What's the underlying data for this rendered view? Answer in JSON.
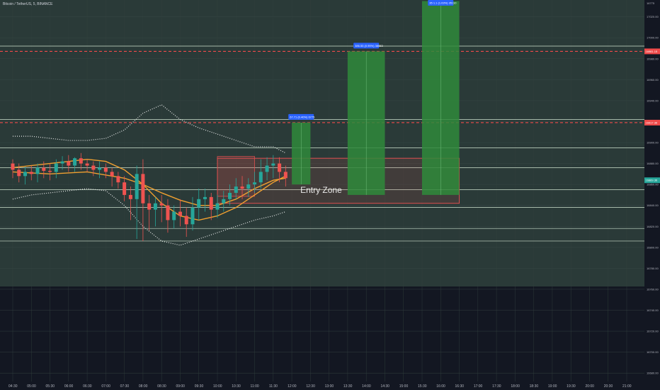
{
  "header": {
    "symbol_line": "Bitcoin / TetherUS, 5, BINANCE"
  },
  "colors": {
    "bg_chart": "#2a3a38",
    "bg_lower": "#131722",
    "hline": "#cfe3cf",
    "red_dash": "#ef4a4a",
    "target_green": "#2f8a3b",
    "zone_border": "#e05050",
    "ma_orange": "#f0a030",
    "bull": "#26a69a",
    "bear": "#ef5350",
    "label_blue": "#2962ff"
  },
  "labels": {
    "entry_zone": "Entry Zone",
    "target_1": "67.71 (0.40%) 6775",
    "target_2": "386.53 (0.95%) 38653",
    "target_3": "35 1.1 (1.03%) 35110",
    "current_price": "16869.36",
    "red_level_1": "16981.15",
    "red_level_2": "16917.36",
    "top_price": "16775"
  },
  "chart_data": {
    "type": "candlestick",
    "title": "",
    "xlabel": "",
    "ylabel": "",
    "ylim": [
      16672,
      17036
    ],
    "x_ticks": [
      "04:30",
      "05:00",
      "05:30",
      "06:00",
      "06:30",
      "07:00",
      "07:30",
      "08:00",
      "08:30",
      "09:00",
      "09:30",
      "10:00",
      "10:30",
      "11:00",
      "11:30",
      "12:00",
      "12:30",
      "13:00",
      "13:30",
      "14:00",
      "14:30",
      "15:00",
      "15:30",
      "16:00",
      "16:30",
      "17:00",
      "17:30",
      "18:00",
      "18:30",
      "19:00",
      "19:30",
      "20:00",
      "20:30",
      "21:00"
    ],
    "y_ticks": [
      17020,
      17000,
      16980,
      16960,
      16940,
      16920,
      16900,
      16880,
      16860,
      16840,
      16820,
      16800,
      16780,
      16760,
      16740,
      16720,
      16700,
      16680
    ],
    "horizontal_levels": [
      16992,
      16922,
      16895,
      16876,
      16855,
      16838,
      16818,
      16806
    ],
    "red_dashed_levels": [
      16987,
      16919
    ],
    "entry_zone": {
      "x_start": "10:00",
      "x_end": "16:30",
      "y_top": 16885,
      "y_bottom": 16842
    },
    "targets": [
      {
        "label": "67.71 (0.40%) 6775",
        "x_start": "12:00",
        "x_end": "12:30",
        "y_bottom": 16860,
        "y_top": 16919
      },
      {
        "label": "386.53 (0.95%) 38653",
        "x_start": "13:30",
        "x_end": "14:30",
        "y_bottom": 16850,
        "y_top": 16987
      },
      {
        "label": "35 1.1 (1.03%) 35110",
        "x_start": "15:30",
        "x_end": "16:30",
        "y_bottom": 16850,
        "y_top": 17035
      }
    ],
    "series": [
      {
        "kind": "candles",
        "x": [
          "04:30",
          "04:40",
          "04:50",
          "05:00",
          "05:10",
          "05:20",
          "05:30",
          "05:40",
          "05:50",
          "06:00",
          "06:10",
          "06:20",
          "06:30",
          "06:40",
          "06:50",
          "07:00",
          "07:10",
          "07:20",
          "07:30",
          "07:40",
          "07:50",
          "08:00",
          "08:10",
          "08:20",
          "08:30",
          "08:40",
          "08:50",
          "09:00",
          "09:10",
          "09:20",
          "09:30",
          "09:40",
          "09:50",
          "10:00",
          "10:10",
          "10:20",
          "10:30",
          "10:40",
          "10:50",
          "11:00",
          "11:10",
          "11:20",
          "11:30",
          "11:40",
          "11:50"
        ],
        "open": [
          16880,
          16874,
          16868,
          16872,
          16870,
          16876,
          16873,
          16872,
          16880,
          16882,
          16878,
          16885,
          16880,
          16878,
          16874,
          16876,
          16872,
          16868,
          16862,
          16850,
          16846,
          16870,
          16842,
          16836,
          16842,
          16840,
          16826,
          16834,
          16830,
          16822,
          16838,
          16846,
          16848,
          16836,
          16842,
          16846,
          16852,
          16858,
          16856,
          16860,
          16862,
          16872,
          16878,
          16880,
          16872
        ],
        "high": [
          16884,
          16880,
          16877,
          16878,
          16880,
          16882,
          16880,
          16884,
          16887,
          16888,
          16886,
          16890,
          16884,
          16882,
          16882,
          16880,
          16876,
          16872,
          16868,
          16858,
          16878,
          16884,
          16850,
          16848,
          16850,
          16846,
          16840,
          16846,
          16838,
          16848,
          16856,
          16856,
          16852,
          16850,
          16854,
          16860,
          16866,
          16868,
          16866,
          16872,
          16884,
          16886,
          16888,
          16886,
          16878
        ],
        "low": [
          16866,
          16862,
          16860,
          16864,
          16862,
          16866,
          16864,
          16866,
          16874,
          16872,
          16872,
          16874,
          16872,
          16868,
          16866,
          16866,
          16858,
          16856,
          16844,
          16826,
          16808,
          16806,
          16816,
          16820,
          16824,
          16814,
          16818,
          16820,
          16810,
          16816,
          16826,
          16834,
          16826,
          16828,
          16834,
          16840,
          16846,
          16846,
          16848,
          16852,
          16856,
          16864,
          16866,
          16862,
          16858
        ],
        "close": [
          16874,
          16868,
          16872,
          16870,
          16876,
          16873,
          16872,
          16880,
          16882,
          16878,
          16885,
          16880,
          16878,
          16874,
          16876,
          16872,
          16868,
          16862,
          16850,
          16846,
          16870,
          16842,
          16836,
          16842,
          16840,
          16826,
          16834,
          16830,
          16822,
          16838,
          16846,
          16848,
          16836,
          16842,
          16846,
          16852,
          16858,
          16856,
          16860,
          16862,
          16872,
          16878,
          16880,
          16872,
          16866
        ]
      },
      {
        "name": "",
        "kind": "line",
        "color": "#f0a030",
        "x": [
          "04:30",
          "05:30",
          "06:30",
          "07:30",
          "08:00",
          "08:30",
          "09:00",
          "09:30",
          "10:00",
          "10:30",
          "11:00",
          "11:30",
          "11:50"
        ],
        "values": [
          16872,
          16870,
          16872,
          16866,
          16860,
          16852,
          16845,
          16840,
          16840,
          16846,
          16856,
          16864,
          16866
        ]
      },
      {
        "name": "",
        "kind": "line",
        "color": "#f0a030",
        "x": [
          "04:30",
          "05:30",
          "06:30",
          "07:00",
          "07:30",
          "08:00",
          "08:30",
          "09:00",
          "09:30",
          "10:00",
          "10:30",
          "11:00",
          "11:30",
          "11:50"
        ],
        "values": [
          16876,
          16880,
          16884,
          16882,
          16874,
          16860,
          16842,
          16830,
          16826,
          16830,
          16838,
          16850,
          16862,
          16868
        ]
      },
      {
        "name": "",
        "kind": "dotted",
        "color": "#ffffff",
        "x": [
          "04:30",
          "05:00",
          "05:30",
          "06:00",
          "06:30",
          "07:00",
          "07:30",
          "08:00",
          "08:30",
          "09:00",
          "09:30",
          "10:00",
          "10:30",
          "11:00",
          "11:30",
          "11:50"
        ],
        "values": [
          16906,
          16906,
          16904,
          16902,
          16902,
          16904,
          16912,
          16928,
          16936,
          16922,
          16914,
          16908,
          16902,
          16896,
          16896,
          16890
        ]
      },
      {
        "name": "",
        "kind": "dotted",
        "color": "#ffffff",
        "x": [
          "04:30",
          "05:00",
          "05:30",
          "06:00",
          "06:30",
          "07:00",
          "07:30",
          "08:00",
          "08:30",
          "09:00",
          "09:30",
          "10:00",
          "10:30",
          "11:00",
          "11:30",
          "11:50"
        ],
        "values": [
          16846,
          16850,
          16852,
          16854,
          16856,
          16854,
          16840,
          16820,
          16806,
          16802,
          16808,
          16814,
          16820,
          16826,
          16830,
          16834
        ]
      }
    ]
  }
}
